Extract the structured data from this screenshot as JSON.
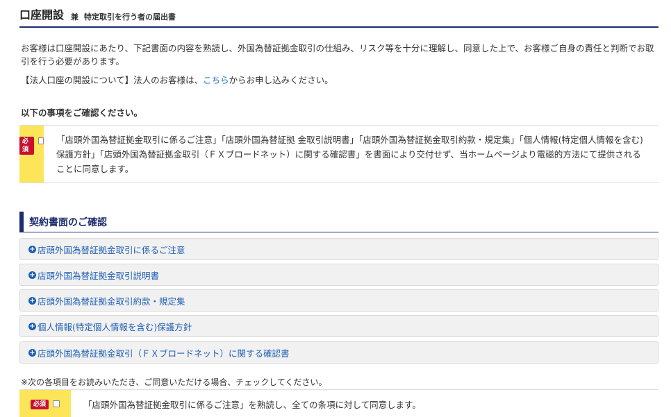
{
  "header": {
    "title": "口座開設",
    "subtitle_mark": "兼",
    "subtitle": "特定取引を行う者の届出書"
  },
  "intro": {
    "text": "お客様は口座開設にあたり、下記書面の内容を熟読し、外国為替証拠金取引の仕組み、リスク等を十分に理解し、同意した上で、お客様ご自身の責任と判断でお取引を行う必要があります。",
    "corporate_prefix": "【法人口座の開設について】法人のお客様は、",
    "corporate_link": "こちら",
    "corporate_suffix": "からお申し込みください。"
  },
  "confirm_heading": "以下の事項をご確認ください。",
  "required_label": "必須",
  "agreement_1": "「店頭外国為替証拠金取引に係るご注意」「店頭外国為替証拠 金取引説明書」「店頭外国為替証拠金取引約款・規定集」「個人情報(特定個人情報を含む)保護方針」「店頭外国為替証拠金取引（ＦＸブロードネット）に関する確認書」を書面により交付せず、当ホームページより電磁的方法にて提供されることに同意します。",
  "section_title": "契約書面のご確認",
  "documents": [
    {
      "label": "店頭外国為替証拠金取引に係るご注意"
    },
    {
      "label": "店頭外国為替証拠金取引説明書"
    },
    {
      "label": "店頭外国為替証拠金取引約款・規定集"
    },
    {
      "label": "個人情報(特定個人情報を含む)保護方針"
    },
    {
      "label": "店頭外国為替証拠金取引（ＦＸブロードネット）に関する確認書"
    }
  ],
  "note": "※次の各項目をお読みいただき、ご同意いただける場合、チェックしてください。",
  "agreement_2": "「店頭外国為替証拠金取引に係るご注意」を熟読し、全ての条項に対して同意します。",
  "icons": {
    "accordion": "plus-circle-icon"
  },
  "colors": {
    "navy": "#1d2e6e",
    "link": "#1a6fc4",
    "required": "#c8102e",
    "highlight": "#fde55a"
  }
}
